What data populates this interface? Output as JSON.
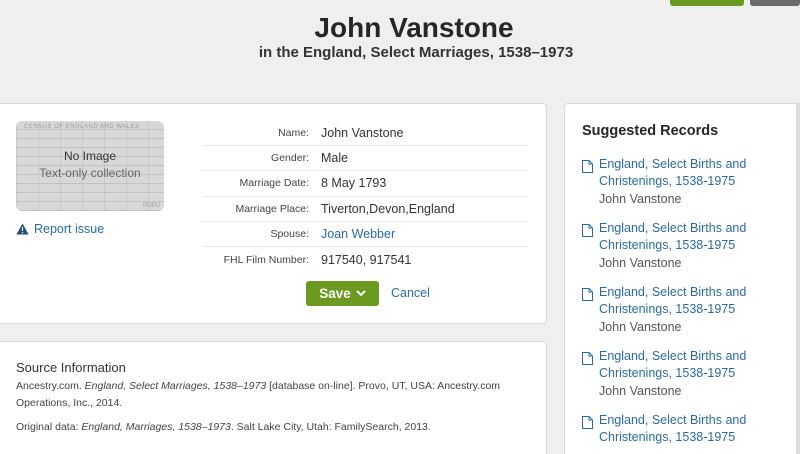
{
  "header": {
    "title": "John Vanstone",
    "subtitle": "in the England, Select Marriages, 1538–1973"
  },
  "record": {
    "thumbnail": {
      "header_text": "CENSUS OF ENGLAND AND WALES",
      "footer_text": "POPU",
      "no_image": "No Image",
      "collection_type": "Text-only collection"
    },
    "report_issue": "Report issue",
    "fields": [
      {
        "label": "Name:",
        "value": "John Vanstone"
      },
      {
        "label": "Gender:",
        "value": "Male"
      },
      {
        "label": "Marriage Date:",
        "value": "8 May 1793"
      },
      {
        "label": "Marriage Place:",
        "value": "Tiverton,Devon,England"
      },
      {
        "label": "Spouse:",
        "value": "Joan Webber"
      },
      {
        "label": "FHL Film Number:",
        "value": "917540, 917541"
      }
    ],
    "save_label": "Save",
    "cancel_label": "Cancel"
  },
  "source": {
    "title": "Source Information",
    "citation_prefix": "Ancestry.com. ",
    "citation_italic": "England, Select Marriages, 1538–1973",
    "citation_suffix": " [database on-line]. Provo, UT, USA: Ancestry.com Operations, Inc., 2014.",
    "original_prefix": "Original data: ",
    "original_italic": "England, Marriages, 1538–1973",
    "original_suffix": ". Salt Lake City, Utah: FamilySearch, 2013."
  },
  "suggested": {
    "title": "Suggested Records",
    "items": [
      {
        "collection": "England, Select Births and Christenings, 1538-1975",
        "name": "John Vanstone"
      },
      {
        "collection": "England, Select Births and Christenings, 1538-1975",
        "name": "John Vanstone"
      },
      {
        "collection": "England, Select Births and Christenings, 1538-1975",
        "name": "John Vanstone"
      },
      {
        "collection": "England, Select Births and Christenings, 1538-1975",
        "name": "John Vanstone"
      },
      {
        "collection": "England, Select Births and Christenings, 1538-1975",
        "name": ""
      }
    ]
  },
  "colors": {
    "accent_green": "#6a9a1f",
    "link_blue": "#2a6ba6",
    "background": "#efefef"
  },
  "icons": [
    "warning-icon",
    "chevron-down-icon",
    "document-icon",
    "info-icon"
  ]
}
